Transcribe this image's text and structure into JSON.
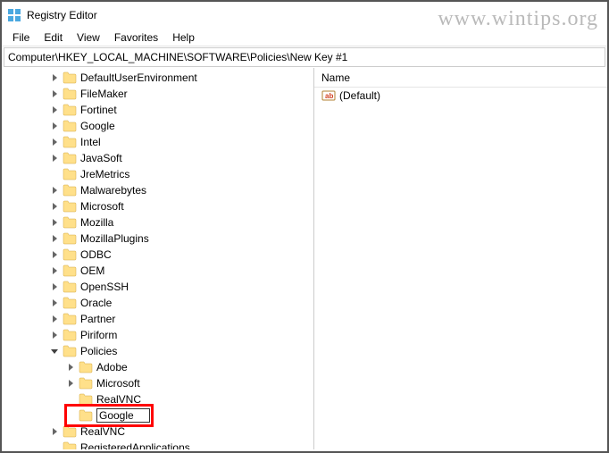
{
  "window": {
    "title": "Registry Editor"
  },
  "menu": {
    "file": "File",
    "edit": "Edit",
    "view": "View",
    "favorites": "Favorites",
    "help": "Help"
  },
  "address": {
    "path": "Computer\\HKEY_LOCAL_MACHINE\\SOFTWARE\\Policies\\New Key #1"
  },
  "values_header": {
    "name": "Name"
  },
  "values": {
    "default_label": "(Default)"
  },
  "tree": {
    "items": [
      {
        "label": "DefaultUserEnvironment",
        "indent": 52,
        "exp": "right"
      },
      {
        "label": "FileMaker",
        "indent": 52,
        "exp": "right"
      },
      {
        "label": "Fortinet",
        "indent": 52,
        "exp": "right"
      },
      {
        "label": "Google",
        "indent": 52,
        "exp": "right"
      },
      {
        "label": "Intel",
        "indent": 52,
        "exp": "right"
      },
      {
        "label": "JavaSoft",
        "indent": 52,
        "exp": "right"
      },
      {
        "label": "JreMetrics",
        "indent": 52,
        "exp": "none"
      },
      {
        "label": "Malwarebytes",
        "indent": 52,
        "exp": "right"
      },
      {
        "label": "Microsoft",
        "indent": 52,
        "exp": "right"
      },
      {
        "label": "Mozilla",
        "indent": 52,
        "exp": "right"
      },
      {
        "label": "MozillaPlugins",
        "indent": 52,
        "exp": "right"
      },
      {
        "label": "ODBC",
        "indent": 52,
        "exp": "right"
      },
      {
        "label": "OEM",
        "indent": 52,
        "exp": "right"
      },
      {
        "label": "OpenSSH",
        "indent": 52,
        "exp": "right"
      },
      {
        "label": "Oracle",
        "indent": 52,
        "exp": "right"
      },
      {
        "label": "Partner",
        "indent": 52,
        "exp": "right"
      },
      {
        "label": "Piriform",
        "indent": 52,
        "exp": "right"
      },
      {
        "label": "Policies",
        "indent": 52,
        "exp": "down"
      },
      {
        "label": "Adobe",
        "indent": 70,
        "exp": "right"
      },
      {
        "label": "Microsoft",
        "indent": 70,
        "exp": "right"
      },
      {
        "label": "RealVNC",
        "indent": 70,
        "exp": "none"
      },
      {
        "label": "Google",
        "indent": 70,
        "exp": "none",
        "editing": true
      },
      {
        "label": "RealVNC",
        "indent": 52,
        "exp": "right"
      },
      {
        "label": "RegisteredApplications",
        "indent": 52,
        "exp": "none"
      }
    ]
  },
  "watermark": "www.wintips.org"
}
